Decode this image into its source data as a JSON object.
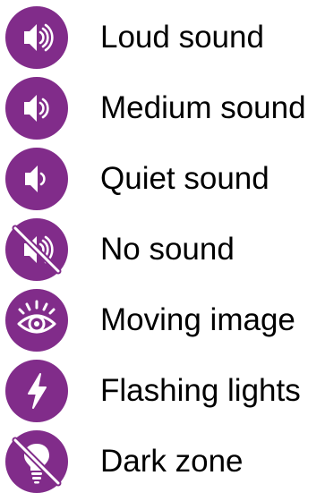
{
  "legend": {
    "accent_color": "#812c8a",
    "icon_color": "#ffffff",
    "items": [
      {
        "icon": "speaker-loud-icon",
        "label": "Loud sound"
      },
      {
        "icon": "speaker-medium-icon",
        "label": "Medium sound"
      },
      {
        "icon": "speaker-quiet-icon",
        "label": "Quiet sound"
      },
      {
        "icon": "speaker-muted-icon",
        "label": "No sound"
      },
      {
        "icon": "eye-icon",
        "label": "Moving image"
      },
      {
        "icon": "lightning-icon",
        "label": "Flashing lights"
      },
      {
        "icon": "lightbulb-off-icon",
        "label": "Dark zone"
      }
    ]
  }
}
